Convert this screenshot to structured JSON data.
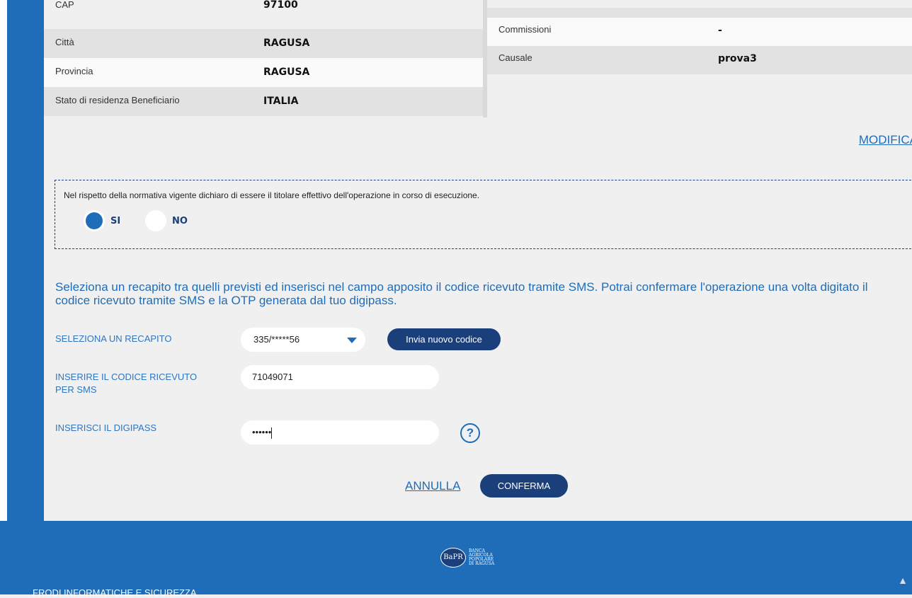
{
  "left_table": [
    {
      "label": "CAP",
      "value": "97100"
    },
    {
      "label": "Città",
      "value": "RAGUSA"
    },
    {
      "label": "Provincia",
      "value": "RAGUSA"
    },
    {
      "label": "Stato di residenza Beneficiario",
      "value": "ITALIA"
    }
  ],
  "right_table": [
    {
      "label": "Commissioni",
      "value": "-"
    },
    {
      "label": "Causale",
      "value": "prova3"
    }
  ],
  "modifica_link": "MODIFICA",
  "declaration": {
    "text": "Nel rispetto della normativa vigente dichiaro di essere il titolare effettivo dell'operazione in corso di esecuzione.",
    "options": [
      {
        "label": "SI",
        "selected": true
      },
      {
        "label": "NO",
        "selected": false
      }
    ]
  },
  "instruction": "Seleziona un recapito tra quelli previsti ed inserisci nel campo apposito il codice ricevuto tramite SMS. Potrai confermare l'operazione una volta digitato il codice ricevuto tramite SMS e la OTP generata dal tuo digipass.",
  "form": {
    "recapito_label": "SELEZIONA UN RECAPITO",
    "recapito_value": "335/*****56",
    "send_new_code": "Invia nuovo codice",
    "sms_code_label_line1": "INSERIRE IL CODICE RICEVUTO",
    "sms_code_label_line2": "PER SMS",
    "sms_code_value": "71049071",
    "digipass_label": "INSERISCI IL DIGIPASS",
    "digipass_value": "••••••",
    "help_symbol": "?"
  },
  "actions": {
    "cancel": "ANNULLA",
    "confirm": "CONFERMA"
  },
  "footer": {
    "logo_mark": "BaPR",
    "logo_lines": [
      "BANCA",
      "AGRICOLA",
      "POPOLARE",
      "DI RAGUSA"
    ],
    "link": "FRODI INFORMATICHE E SICUREZZA",
    "scroll_top_icon": "arrow-up-icon"
  },
  "colors": {
    "brand_blue": "#1f6db8",
    "dark_navy": "#1a3f7a"
  }
}
